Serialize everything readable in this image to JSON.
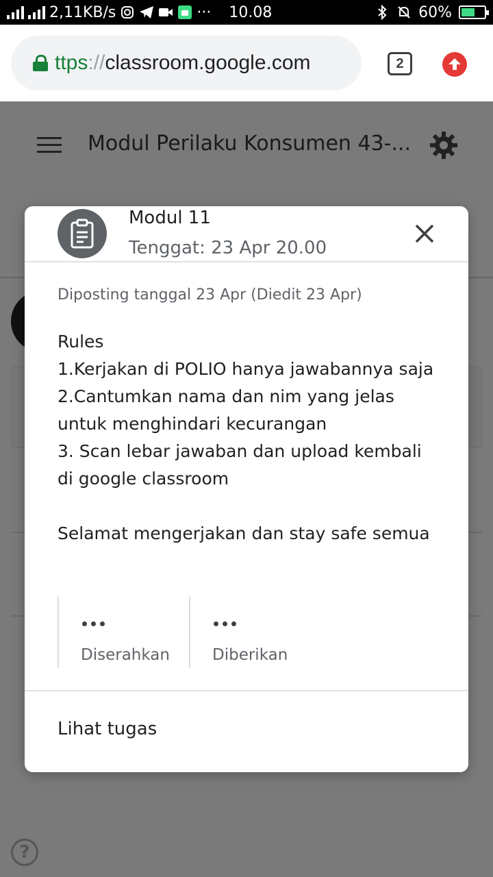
{
  "status_bar": {
    "speed": "2,11KB/s",
    "time": "10.08",
    "battery": "60%",
    "battery_level": 0.6,
    "more": "···"
  },
  "browser": {
    "url_scheme": "ttps",
    "url_sep": "://",
    "url_host": "classroom.google.com",
    "tab_count": "2"
  },
  "app": {
    "title": "Modul Perilaku Konsumen 43-..."
  },
  "dialog": {
    "title": "Modul 11",
    "due": "Tenggat: 23 Apr 20.00",
    "posted": "Diposting tanggal 23 Apr (Diedit 23 Apr)",
    "body": "Rules\n1.Kerjakan di POLIO hanya jawabannya saja\n2.Cantumkan nama dan nim yang jelas untuk menghindari kecurangan\n3. Scan lebar jawaban dan upload kembali di google classroom\n\nSelamat mengerjakan dan stay safe semua",
    "stats": [
      {
        "label": "Diserahkan"
      },
      {
        "label": "Diberikan"
      }
    ],
    "view_link": "Lihat tugas"
  },
  "colors": {
    "accent_green": "#188038",
    "update_red": "#e53935",
    "scrim": "#7a7a7a"
  }
}
